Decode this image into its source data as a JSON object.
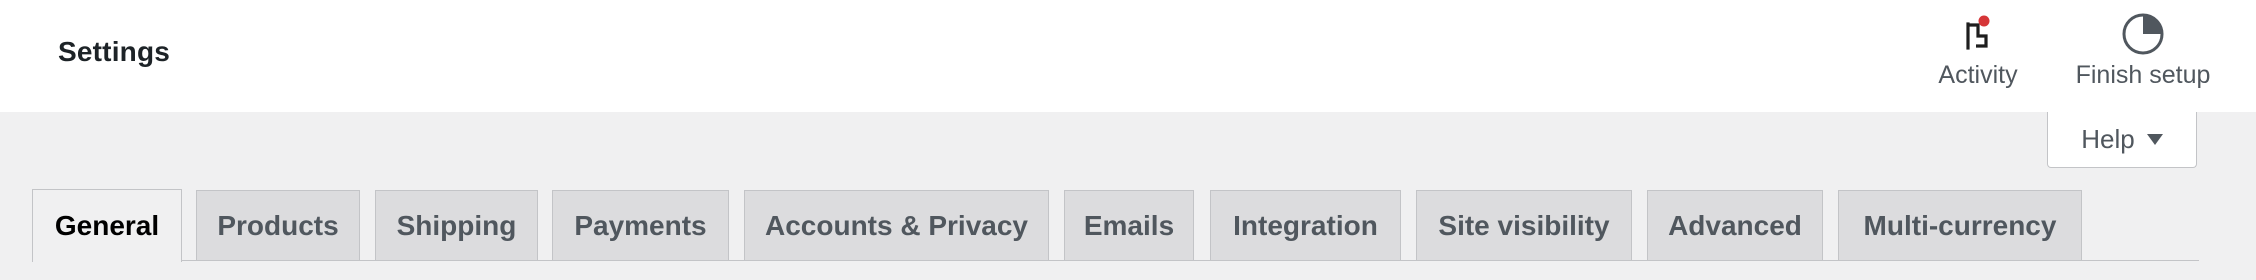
{
  "header": {
    "title": "Settings",
    "activity": {
      "label": "Activity",
      "icon": "flag-icon",
      "has_notification": true
    },
    "finish_setup": {
      "label": "Finish setup",
      "icon": "pie-progress-icon"
    }
  },
  "help": {
    "label": "Help",
    "icon": "caret-down-icon"
  },
  "tabs": [
    {
      "label": "General",
      "active": true
    },
    {
      "label": "Products"
    },
    {
      "label": "Shipping"
    },
    {
      "label": "Payments"
    },
    {
      "label": "Accounts & Privacy"
    },
    {
      "label": "Emails"
    },
    {
      "label": "Integration"
    },
    {
      "label": "Site visibility"
    },
    {
      "label": "Advanced"
    },
    {
      "label": "Multi-currency"
    }
  ],
  "colors": {
    "notification_dot": "#d63638",
    "tab_inactive_bg": "#dcdcde",
    "page_bg": "#f0f0f1"
  }
}
